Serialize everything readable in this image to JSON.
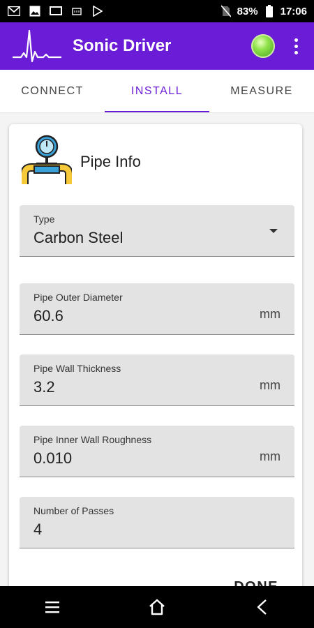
{
  "status_bar": {
    "battery": "83%",
    "time": "17:06",
    "icons": [
      "gmail-icon",
      "image-icon",
      "screen-icon",
      "sd-card-icon",
      "play-store-icon",
      "no-sim-icon",
      "battery-icon"
    ]
  },
  "app_bar": {
    "title": "Sonic Driver",
    "logo_icon": "waveform-logo-icon",
    "status_color": "#5fc52c",
    "accent": "#6a1cd6"
  },
  "tabs": [
    {
      "label": "CONNECT",
      "active": false
    },
    {
      "label": "INSTALL",
      "active": true
    },
    {
      "label": "MEASURE",
      "active": false
    }
  ],
  "card": {
    "title": "Pipe Info",
    "icon": "pipe-gauge-icon",
    "fields": [
      {
        "label": "Type",
        "value": "Carbon Steel",
        "unit": "",
        "kind": "dropdown"
      },
      {
        "label": "Pipe Outer Diameter",
        "value": "60.6",
        "unit": "mm",
        "kind": "input"
      },
      {
        "label": "Pipe Wall Thickness",
        "value": "3.2",
        "unit": "mm",
        "kind": "input"
      },
      {
        "label": "Pipe Inner Wall Roughness",
        "value": "0.010",
        "unit": "mm",
        "kind": "input"
      },
      {
        "label": "Number of Passes",
        "value": "4",
        "unit": "",
        "kind": "input"
      }
    ],
    "done_label": "DONE"
  },
  "nav_bar": {
    "buttons": [
      "menu-icon",
      "home-icon",
      "back-icon"
    ]
  }
}
